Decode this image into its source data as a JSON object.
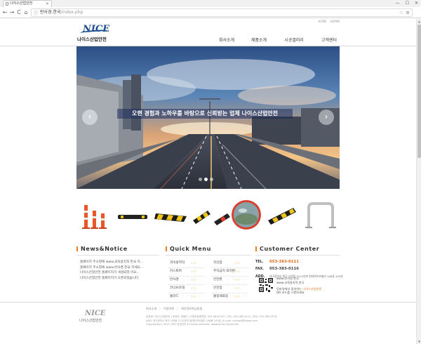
{
  "browser": {
    "tab_title": "나이스산업안전",
    "tab_close": "×",
    "win_min": "—",
    "win_max": "☐",
    "win_close": "✕",
    "back": "←",
    "forward": "→",
    "reload": "C",
    "home": "⌂",
    "lock": "ⓘ",
    "url_host": "반사경.한국",
    "url_path": "/index.php",
    "star": "☆",
    "menu": "≡"
  },
  "util_links": [
    "HOME",
    "ADMIN"
  ],
  "logo": {
    "brand": "NICE",
    "name": "나이스산업안전"
  },
  "gnb": [
    "회사소개",
    "제품소개",
    "시공갤러리",
    "고객센터"
  ],
  "hero": {
    "caption": "오랜 경험과 노하우를 바탕으로 신뢰받는 업체 나이스산업안전",
    "prev": "‹",
    "next": "›",
    "slide_count": 3,
    "active_slide": 1
  },
  "products": [
    "traffic-cones",
    "curb-stopper",
    "speed-bump",
    "parking-stopper",
    "parking-stopper-small",
    "convex-mirror",
    "wheel-guard",
    "u-barrier"
  ],
  "colors": {
    "accent": "#f07c1e",
    "brand": "#1d4f91",
    "quick_arrow": "#f2a31f"
  },
  "news": {
    "title": "News&Notice",
    "items": [
      "홈페이지 주소창에 www.교육용지적 한국 치...",
      "홈페이지 주소창에 www.반사경.한국 치세요...",
      "나이스산업안전 홈페이지가 개설되었 어요...",
      "나이스산업안전 홈페이지가 오픈되었습니다"
    ]
  },
  "quick": {
    "title": "Quick  Menu",
    "left": [
      "과속방지턱",
      "카스토퍼",
      "반사경",
      "코너보호대",
      "볼라드"
    ],
    "right": [
      "차선봉",
      "주차금지 표지판",
      "안전판",
      "안전망",
      "볼링래프봉"
    ],
    "arrow": "›››"
  },
  "cs": {
    "title": "Customer  Center",
    "tel_label": "TEL.",
    "tel": "053-383-0111",
    "fax_label": "FAX.",
    "fax": "053-383-0116",
    "addr_label": "ADD.",
    "addr": "대구광역시 북구 산격동 1212번지 현대하이츠빌라 106동 102호",
    "qr_lines": [
      "www.반사경.한국",
      "www.교육용지적.한국"
    ],
    "qr_line3a": "모바일에서 접속하는 ",
    "qr_line3b": "나이스산업안전",
    "qr_line4": "QR 코드를 스캔하세요"
  },
  "footer": {
    "brand": "NICE",
    "name": "나이스산업안전",
    "links": [
      "회사소개",
      "이용약관",
      "개인정보취급방침"
    ],
    "sep": "|",
    "info": [
      "상호명: 나이스산업안전 | 대표자: 정봉곤 | 사업자등록번호: 503-08-62147 | TEL: 053-383-0111 | FAX: 053-383-0116",
      "ADD: 대구광역시 북구 산격동 1212번지 현대하이츠빌라 106동 102호 | E-mail: nicesaft@naver.com",
      "Copyrights(c) 2015 나이스산업안전 All rights reserved. powered by Dynos INC."
    ]
  }
}
